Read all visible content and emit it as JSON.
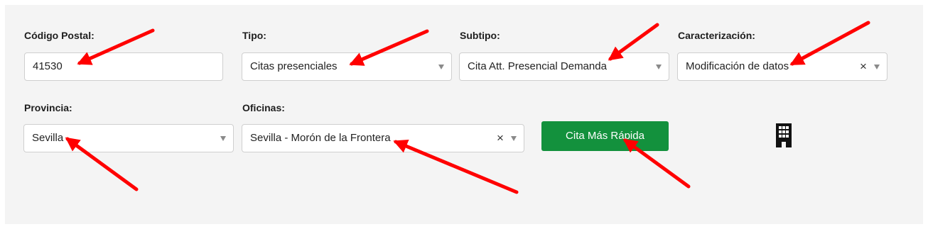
{
  "form": {
    "codigo_postal": {
      "label": "Código Postal:",
      "value": "41530"
    },
    "tipo": {
      "label": "Tipo:",
      "value": "Citas presenciales"
    },
    "subtipo": {
      "label": "Subtipo:",
      "value": "Cita Att. Presencial Demanda"
    },
    "caracterizacion": {
      "label": "Caracterización:",
      "value": "Modificación de datos",
      "clear": "×"
    },
    "provincia": {
      "label": "Provincia:",
      "value": "Sevilla"
    },
    "oficinas": {
      "label": "Oficinas:",
      "value": "Sevilla - Morón de la Frontera",
      "clear": "×"
    },
    "submit_label": "Cita Más Rápida"
  },
  "icons": {
    "building": "building-icon",
    "dropdown": "chevron-down-icon",
    "clear": "close-icon"
  },
  "colors": {
    "panel_bg": "#f4f4f4",
    "button_bg": "#13913d",
    "annotation_arrow": "#ff0000"
  }
}
